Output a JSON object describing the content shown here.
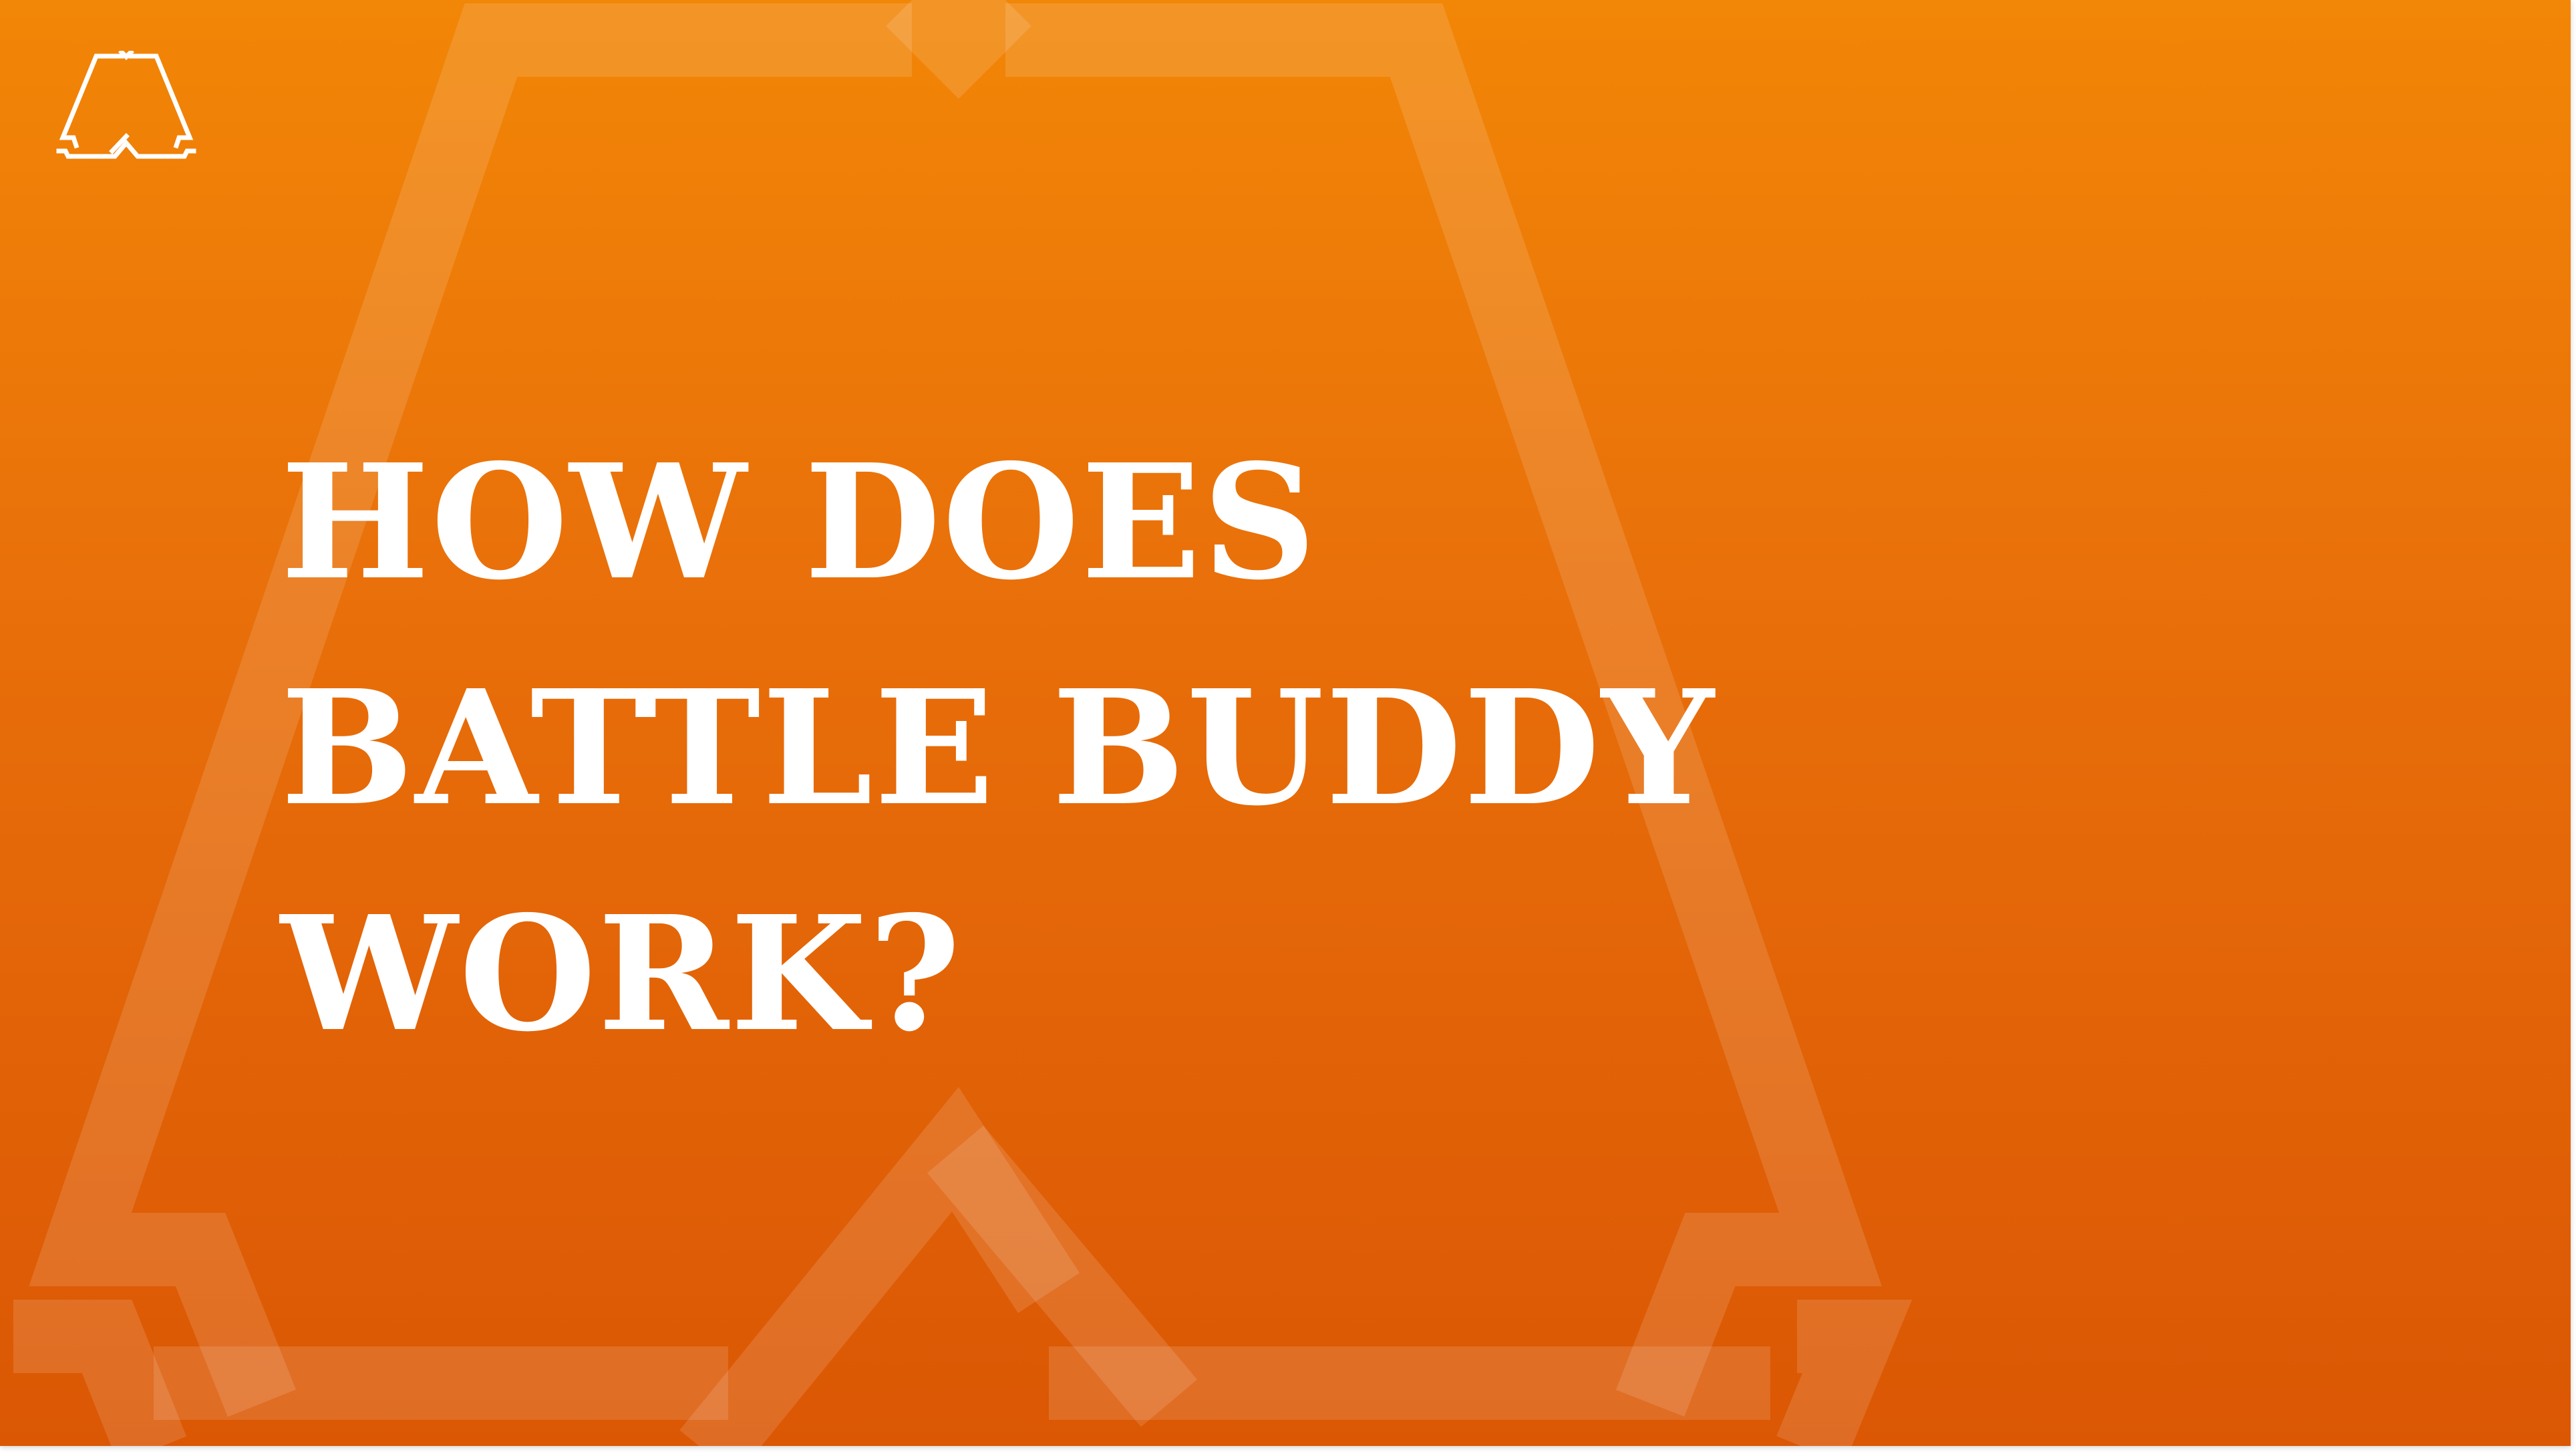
{
  "slide": {
    "background_top_color": "#f28606",
    "background_bottom_color": "#db5704",
    "text_color": "#ffffff",
    "logo_icon": "battle-buddy-a-logo-icon",
    "emblem_icon": "large-a-emblem-outline-icon",
    "headline": {
      "line1": "HOW DOES",
      "line2": "BATTLE BUDDY",
      "line3": "WORK?"
    }
  }
}
